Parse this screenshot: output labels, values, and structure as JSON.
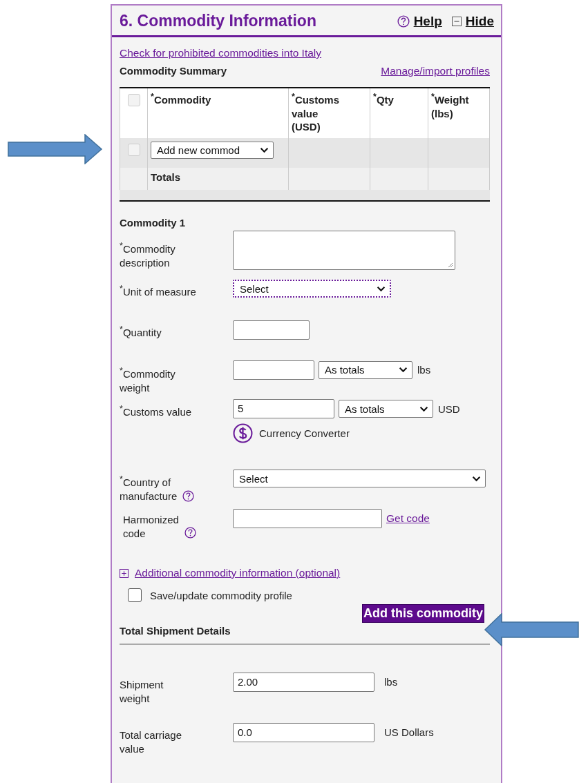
{
  "section": {
    "title": "6. Commodity Information",
    "help_link": "Help",
    "hide_link": "Hide"
  },
  "prohibited_link": "Check for prohibited commodities into Italy",
  "summary": {
    "heading": "Commodity Summary",
    "manage_link": "Manage/import profiles",
    "header_checked": false,
    "columns": [
      "$^{*}$Commodity",
      "$^{*}$Customs\nvalue\n(USD)",
      "$^{*}$Qty",
      "$^{*}$Weight\n(lbs)"
    ],
    "rows": [
      {
        "checked": false,
        "commodity": "Add new commod"
      }
    ],
    "totals_label": "Totals"
  },
  "commodity": {
    "heading": "Commodity 1",
    "fields": [
      {
        "kind": "description",
        "label": "$^{*}$Commodity\ndescription"
      },
      {
        "kind": "unit",
        "label": "$^{*}$Unit of measure",
        "select": "Select",
        "focused": true
      },
      {
        "kind": "quantity",
        "label": "$^{*}$Quantity"
      },
      {
        "kind": "weight",
        "label": "$^{*}$Commodity\nweight",
        "select": "As totals",
        "unit": "lbs"
      },
      {
        "kind": "customs",
        "label": "$^{*}$Customs value",
        "value": "5",
        "select": "As totals",
        "unit": "USD",
        "converter": "Currency Converter"
      },
      {
        "kind": "country",
        "label": "$^{*}$Country of\nmanufacture",
        "select": "Select",
        "help": true
      },
      {
        "kind": "harmonized",
        "label": "Harmonized\ncode",
        "help": true,
        "link": "Get code"
      }
    ],
    "additional_link": "Additional commodity information (optional)",
    "save_profile": {
      "label": "Save/update commodity profile",
      "checked": false
    },
    "add_button": "Add this commodity"
  },
  "shipment": {
    "heading": "Total Shipment Details",
    "fields": [
      {
        "label": "Shipment\nweight",
        "value": "2.00",
        "unit": "lbs"
      },
      {
        "label": "Total carriage\nvalue",
        "value": "0.0",
        "unit": "US Dollars"
      }
    ]
  }
}
